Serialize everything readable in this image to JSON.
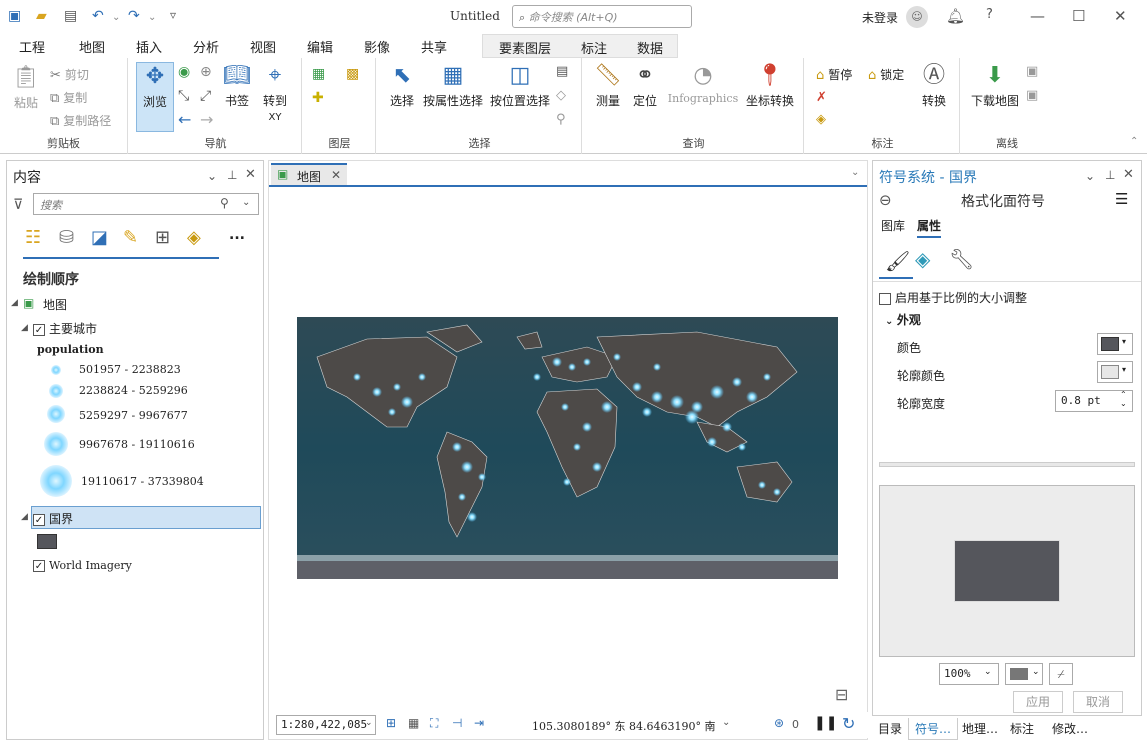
{
  "titlebar": {
    "title": "Untitled",
    "command_search_placeholder": "命令搜索 (Alt+Q)",
    "user_label": "未登录"
  },
  "tabs": [
    "工程",
    "地图",
    "插入",
    "分析",
    "视图",
    "编辑",
    "影像",
    "共享"
  ],
  "active_tab": "地图",
  "context_tabs": [
    "要素图层",
    "标注",
    "数据"
  ],
  "ribbon": {
    "clipboard": {
      "label": "剪贴板",
      "paste": "粘贴",
      "cut": "剪切",
      "copy": "复制",
      "copy_path": "复制路径"
    },
    "navigate": {
      "label": "导航",
      "explore": "浏览",
      "bookmarks": "书签",
      "goto_xy": "转到",
      "goto_xy_sub": "XY"
    },
    "layer": {
      "label": "图层"
    },
    "selection": {
      "label": "选择",
      "select": "选择",
      "by_attr": "按属性选择",
      "by_loc": "按位置选择"
    },
    "inquiry": {
      "label": "查询",
      "measure": "测量",
      "locate": "定位",
      "infographics": "Infographics",
      "coord": "坐标转换"
    },
    "labeling": {
      "label": "标注",
      "pause": "暂停",
      "lock": "锁定",
      "convert": "转换"
    },
    "offline": {
      "label": "离线",
      "download": "下载地图"
    }
  },
  "contents": {
    "title": "内容",
    "search_placeholder": "搜索",
    "draw_order": "绘制顺序",
    "map_name": "地图",
    "layer_cities": "主要城市",
    "field": "population",
    "classes": [
      "501957 - 2238823",
      "2238824 - 5259296",
      "5259297 - 9967677",
      "9967678 - 19110616",
      "19110617 - 37339804"
    ],
    "layer_borders": "国界",
    "layer_imagery": "World Imagery",
    "more": "..."
  },
  "map_view": {
    "tab_label": "地图",
    "scale": "1:280,422,085",
    "coords": "105.3080189° 东  84.6463190° 南",
    "selected_count": "0"
  },
  "symbology": {
    "title": "符号系统 - 国界",
    "subtitle": "格式化面符号",
    "tab_gallery": "图库",
    "tab_properties": "属性",
    "scale_sizing": "启用基于比例的大小调整",
    "section": "外观",
    "color_label": "颜色",
    "outline_color_label": "轮廓颜色",
    "outline_width_label": "轮廓宽度",
    "outline_width_value": "0.8 pt",
    "zoom": "100%",
    "apply": "应用",
    "cancel": "取消",
    "fill_color": "#55565c"
  },
  "bottom_tabs": [
    "目录",
    "符号…",
    "地理…",
    "标注",
    "修改…"
  ]
}
